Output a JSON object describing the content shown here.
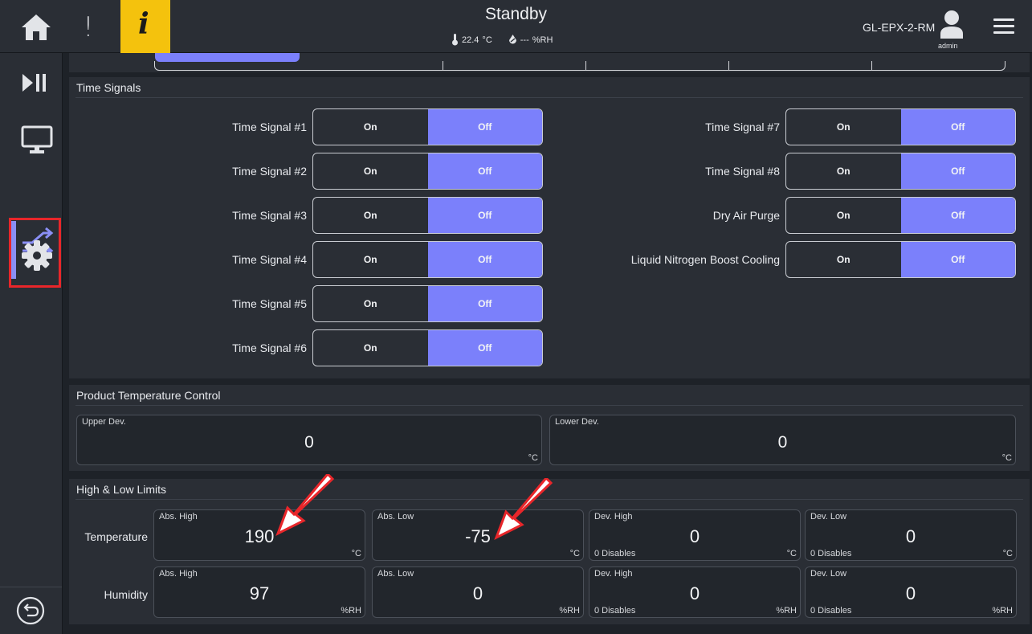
{
  "header": {
    "state": "Standby",
    "temperature_reading": "22.4",
    "temperature_unit": "°C",
    "humidity_reading": "---",
    "humidity_unit": "%RH",
    "device_name": "GL-EPX-2-RM",
    "user": "admin",
    "info_glyph": "i",
    "alert_glyph": "!"
  },
  "icons": {
    "home": "home-icon",
    "alert": "exclamation-icon",
    "info": "info-icon",
    "user": "user-icon",
    "menu": "hamburger-menu-icon",
    "nav": [
      "play-pause-icon",
      "monitor-icon",
      "profile-arrows-icon",
      "gear-icon"
    ],
    "back": "back-arrow-icon"
  },
  "colors": {
    "accent": "#7b80fb",
    "warning": "#f4c20d",
    "highlight": "#e8262a"
  },
  "time_signals": {
    "title": "Time Signals",
    "on_label": "On",
    "off_label": "Off",
    "left": [
      {
        "label": "Time Signal #1",
        "state": "Off"
      },
      {
        "label": "Time Signal #2",
        "state": "Off"
      },
      {
        "label": "Time Signal #3",
        "state": "Off"
      },
      {
        "label": "Time Signal #4",
        "state": "Off"
      },
      {
        "label": "Time Signal #5",
        "state": "Off"
      },
      {
        "label": "Time Signal #6",
        "state": "Off"
      }
    ],
    "right": [
      {
        "label": "Time Signal #7",
        "state": "Off"
      },
      {
        "label": "Time Signal #8",
        "state": "Off"
      },
      {
        "label": "Dry Air Purge",
        "state": "Off"
      },
      {
        "label": "Liquid Nitrogen Boost Cooling",
        "state": "Off"
      }
    ]
  },
  "product_temp": {
    "title": "Product Temperature Control",
    "upper": {
      "label": "Upper Dev.",
      "value": "0",
      "unit": "°C"
    },
    "lower": {
      "label": "Lower Dev.",
      "value": "0",
      "unit": "°C"
    }
  },
  "limits": {
    "title": "High & Low Limits",
    "temperature": {
      "label": "Temperature",
      "abs_high": {
        "label": "Abs. High",
        "value": "190",
        "unit": "°C"
      },
      "abs_low": {
        "label": "Abs. Low",
        "value": "-75",
        "unit": "°C"
      },
      "dev_high": {
        "label": "Dev. High",
        "value": "0",
        "unit": "°C",
        "note": "0 Disables"
      },
      "dev_low": {
        "label": "Dev. Low",
        "value": "0",
        "unit": "°C",
        "note": "0 Disables"
      }
    },
    "humidity": {
      "label": "Humidity",
      "abs_high": {
        "label": "Abs. High",
        "value": "97",
        "unit": "%RH"
      },
      "abs_low": {
        "label": "Abs. Low",
        "value": "0",
        "unit": "%RH"
      },
      "dev_high": {
        "label": "Dev. High",
        "value": "0",
        "unit": "%RH",
        "note": "0 Disables"
      },
      "dev_low": {
        "label": "Dev. Low",
        "value": "0",
        "unit": "%RH",
        "note": "0 Disables"
      }
    }
  }
}
